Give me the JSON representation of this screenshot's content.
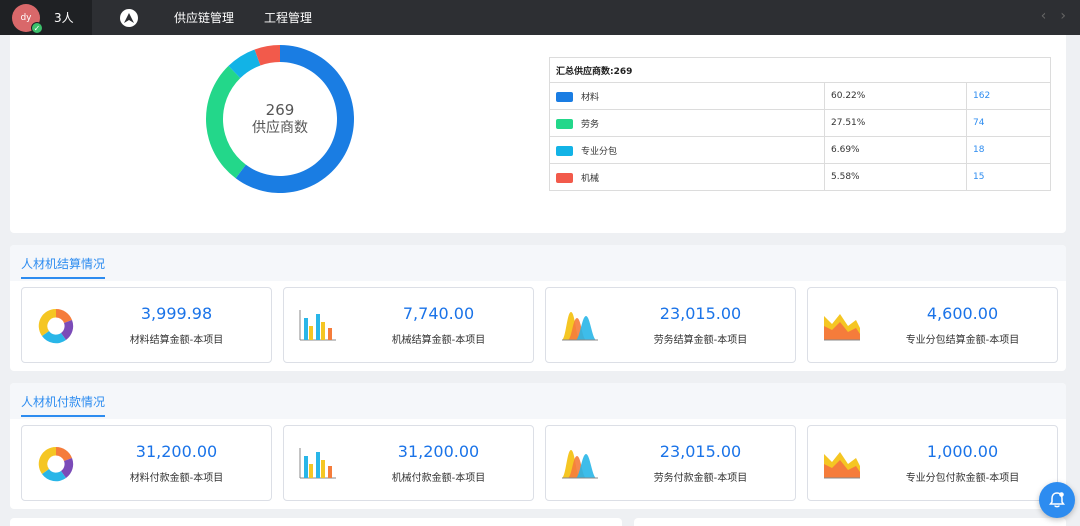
{
  "topbar": {
    "avatar_text": "dy",
    "user_count": "3人",
    "nav_items": [
      "供应链管理",
      "工程管理"
    ]
  },
  "summary": {
    "donut_number": "269",
    "donut_label": "供应商数",
    "table_header": "汇总供应商数:269",
    "rows": [
      {
        "name": "材料",
        "percent": "60.22%",
        "count": "162",
        "color": "#1a7de3"
      },
      {
        "name": "劳务",
        "percent": "27.51%",
        "count": "74",
        "color": "#23d78a"
      },
      {
        "name": "专业分包",
        "percent": "6.69%",
        "count": "18",
        "color": "#12b3e6"
      },
      {
        "name": "机械",
        "percent": "5.58%",
        "count": "15",
        "color": "#f25a4b"
      }
    ]
  },
  "chart_data": {
    "type": "pie",
    "categories": [
      "材料",
      "劳务",
      "专业分包",
      "机械"
    ],
    "values": [
      162,
      74,
      18,
      15
    ],
    "colors": [
      "#1a7de3",
      "#23d78a",
      "#12b3e6",
      "#f25a4b"
    ]
  },
  "settlement": {
    "title": "人材机结算情况",
    "cards": [
      {
        "amount": "3,999.98",
        "caption": "材料结算金额-本项目",
        "icon": "donut-chart-icon"
      },
      {
        "amount": "7,740.00",
        "caption": "机械结算金额-本项目",
        "icon": "bar-chart-icon"
      },
      {
        "amount": "23,015.00",
        "caption": "劳务结算金额-本项目",
        "icon": "peak-chart-icon"
      },
      {
        "amount": "4,600.00",
        "caption": "专业分包结算金额-本项目",
        "icon": "area-chart-icon"
      }
    ]
  },
  "payment": {
    "title": "人材机付款情况",
    "cards": [
      {
        "amount": "31,200.00",
        "caption": "材料付款金额-本项目",
        "icon": "donut-chart-icon"
      },
      {
        "amount": "31,200.00",
        "caption": "机械付款金额-本项目",
        "icon": "bar-chart-icon"
      },
      {
        "amount": "23,015.00",
        "caption": "劳务付款金额-本项目",
        "icon": "peak-chart-icon"
      },
      {
        "amount": "1,000.00",
        "caption": "专业分包付款金额-本项目",
        "icon": "area-chart-icon"
      }
    ]
  }
}
